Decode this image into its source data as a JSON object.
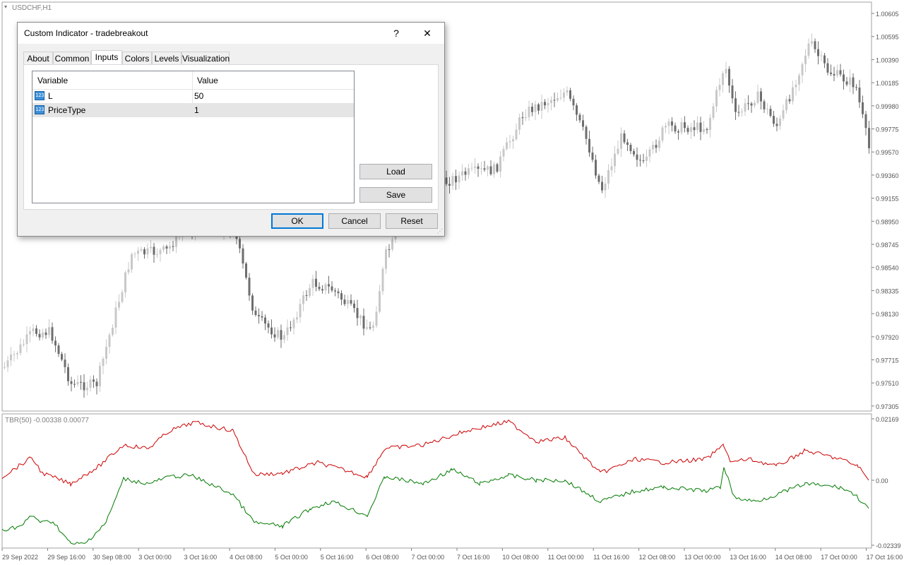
{
  "chart": {
    "symbol_label": "USDCHF,H1",
    "main_price_axis": [
      "1.00605",
      "1.00595",
      "1.00390",
      "1.00185",
      "0.99980",
      "0.99775",
      "0.99570",
      "0.99360",
      "0.99155",
      "0.98950",
      "0.98745",
      "0.98540",
      "0.98335",
      "0.98130",
      "0.97920",
      "0.97715",
      "0.97510",
      "0.97305"
    ],
    "indicator_label": "TBR(50) -0.00338 0.00077",
    "indicator_axis": [
      "0.02169",
      "0.00",
      "-0.02339"
    ],
    "time_axis": [
      "29 Sep 2022",
      "29 Sep 16:00",
      "30 Sep 08:00",
      "3 Oct 00:00",
      "3 Oct 16:00",
      "4 Oct 08:00",
      "5 Oct 00:00",
      "5 Oct 16:00",
      "6 Oct 08:00",
      "7 Oct 00:00",
      "7 Oct 16:00",
      "10 Oct 08:00",
      "11 Oct 00:00",
      "11 Oct 16:00",
      "12 Oct 08:00",
      "13 Oct 00:00",
      "13 Oct 16:00",
      "14 Oct 08:00",
      "17 Oct 00:00",
      "17 Oct 16:00"
    ],
    "colors": {
      "bull": "#c8c8c8",
      "bear": "#6e6e6e",
      "upper_line": "#cc0000",
      "lower_line": "#007a00",
      "grid": "#a0a0a0"
    }
  },
  "dialog": {
    "title": "Custom Indicator - tradebreakout",
    "help_label": "?",
    "close_label": "✕",
    "tabs": [
      "About",
      "Common",
      "Inputs",
      "Colors",
      "Levels",
      "Visualization"
    ],
    "active_tab": "Inputs",
    "grid": {
      "headers": {
        "variable": "Variable",
        "value": "Value"
      },
      "rows": [
        {
          "icon": "123",
          "variable": "L",
          "value": "50"
        },
        {
          "icon": "123",
          "variable": "PriceType",
          "value": "1"
        }
      ]
    },
    "buttons": {
      "load": "Load",
      "save": "Save",
      "ok": "OK",
      "cancel": "Cancel",
      "reset": "Reset"
    }
  }
}
